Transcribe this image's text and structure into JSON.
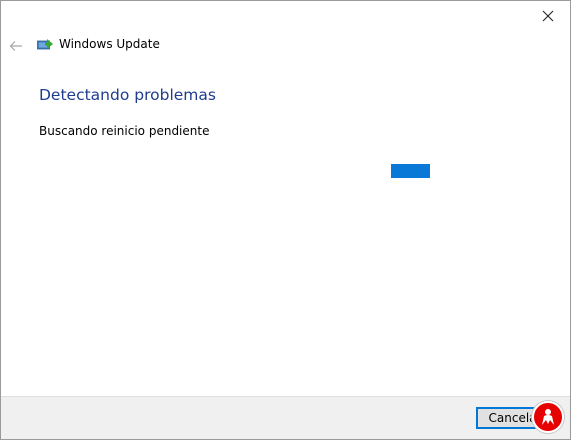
{
  "window": {
    "title": "Windows Update",
    "close_icon": "close-icon",
    "back_icon": "back-arrow-icon",
    "app_icon": "windows-update-icon"
  },
  "content": {
    "heading": "Detectando problemas",
    "status": "Buscando reinicio pendiente"
  },
  "footer": {
    "cancel_label": "Cancelar"
  },
  "colors": {
    "heading": "#1f3d8f",
    "progress": "#0a78d7",
    "footer_bg": "#f0f0f0",
    "watermark": "#e60000"
  },
  "progress": {
    "mode": "indeterminate"
  }
}
